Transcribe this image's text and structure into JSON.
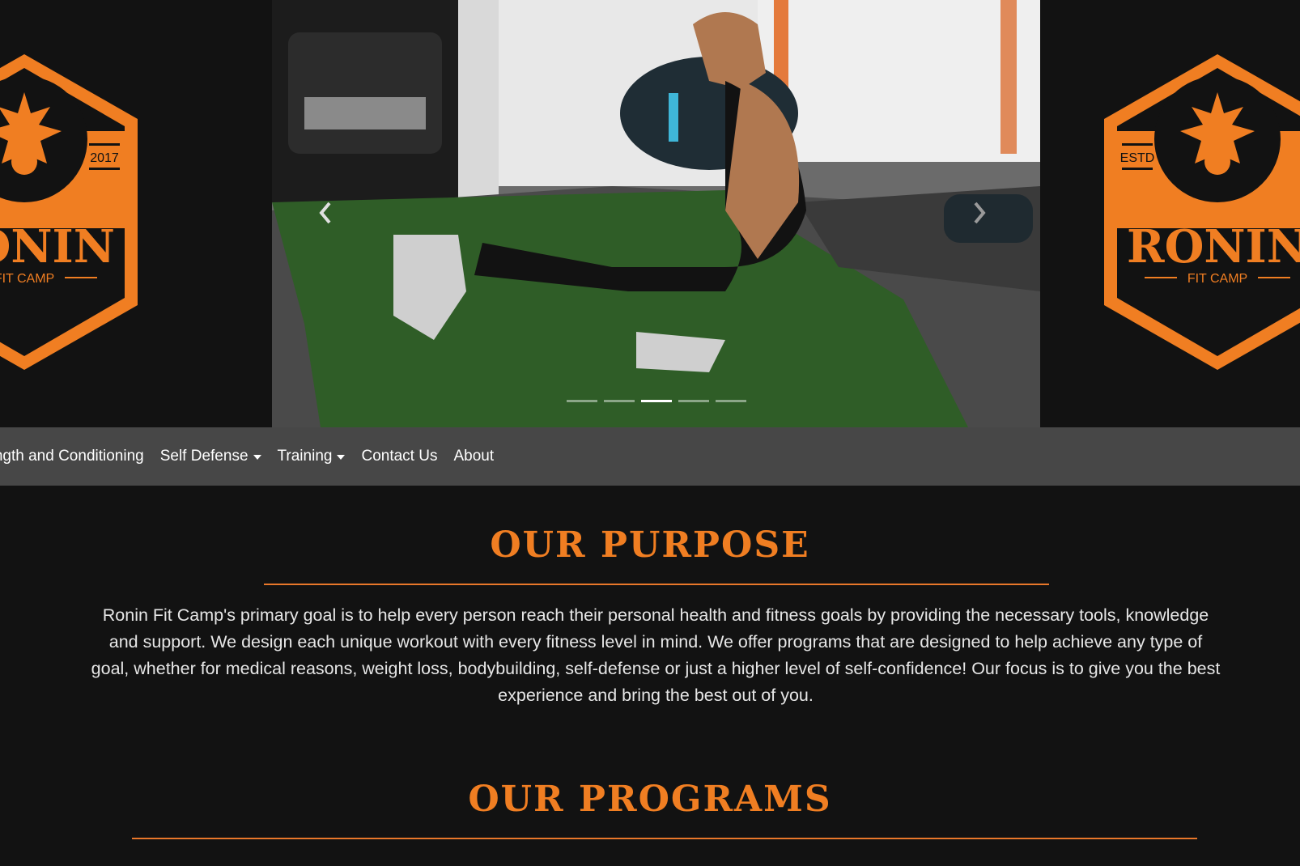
{
  "brand": {
    "name": "RONIN",
    "sub": "FIT CAMP",
    "year": "2017",
    "estd": "ESTD",
    "accent": "#f07e22"
  },
  "carousel": {
    "prev_icon": "chevron-left-icon",
    "next_icon": "chevron-right-icon",
    "slide_count": 5,
    "active_index": 2
  },
  "nav": {
    "items": [
      {
        "label": "Strength and Conditioning",
        "dropdown": false
      },
      {
        "label": "Self Defense",
        "dropdown": true
      },
      {
        "label": "Training",
        "dropdown": true
      },
      {
        "label": "Contact Us",
        "dropdown": false
      },
      {
        "label": "About",
        "dropdown": false
      }
    ]
  },
  "purpose": {
    "title": "OUR PURPOSE",
    "text": "Ronin Fit Camp's primary goal is to help every person reach their personal health and fitness goals by providing the necessary tools, knowledge and support. We design each unique workout with every fitness level in mind. We offer programs that are designed to help achieve any type of goal, whether for medical reasons, weight loss, bodybuilding, self-defense or just a higher level of self-confidence! Our focus is to give you the best experience and bring the best out of you."
  },
  "programs": {
    "title": "OUR PROGRAMS"
  }
}
